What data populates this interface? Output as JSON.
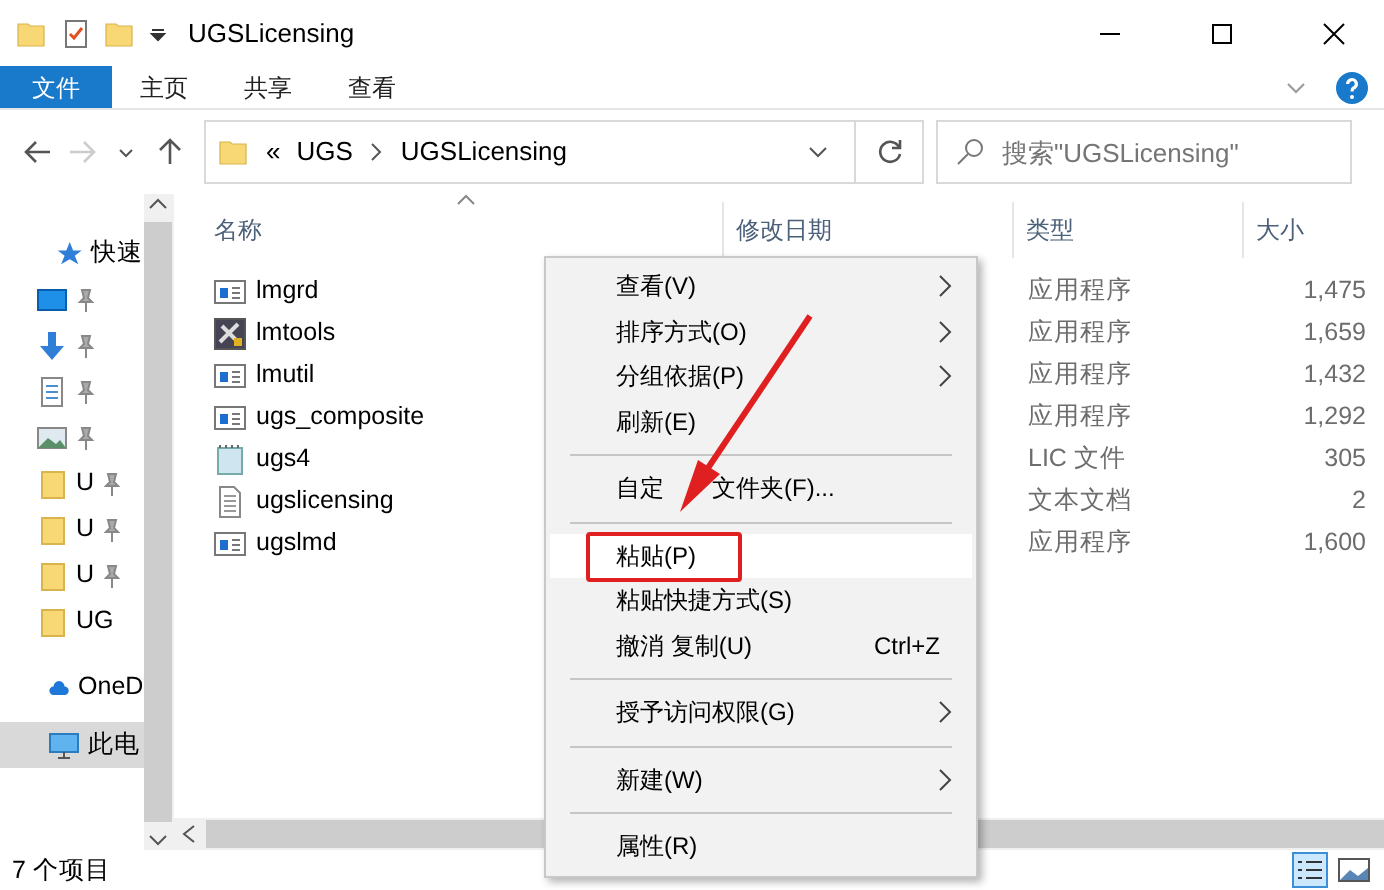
{
  "window": {
    "title": "UGSLicensing"
  },
  "ribbon_tabs": [
    {
      "label": "文件",
      "selected": true
    },
    {
      "label": "主页",
      "selected": false
    },
    {
      "label": "共享",
      "selected": false
    },
    {
      "label": "查看",
      "selected": false
    }
  ],
  "address": {
    "prefix": "«",
    "segments": [
      "UGS",
      "UGSLicensing"
    ]
  },
  "search": {
    "placeholder": "搜索\"UGSLicensing\""
  },
  "nav_items": [
    {
      "kind": "star",
      "label": "快速",
      "pinned": false,
      "selected": false
    },
    {
      "kind": "desktop",
      "pinned": true,
      "selected": false
    },
    {
      "kind": "download",
      "pinned": true,
      "selected": false
    },
    {
      "kind": "document",
      "pinned": true,
      "selected": false
    },
    {
      "kind": "image",
      "pinned": true,
      "selected": false
    },
    {
      "kind": "folder",
      "label": "U",
      "pinned": true,
      "selected": false
    },
    {
      "kind": "folder",
      "label": "U",
      "pinned": true,
      "selected": false
    },
    {
      "kind": "folder",
      "label": "U",
      "pinned": true,
      "selected": false
    },
    {
      "kind": "folder",
      "label": "UG",
      "pinned": false,
      "selected": false
    },
    {
      "kind": "cloud",
      "label": "OneD",
      "pinned": false,
      "selected": false
    },
    {
      "kind": "pc",
      "label": "此电",
      "pinned": false,
      "selected": true
    }
  ],
  "columns": [
    "名称",
    "修改日期",
    "类型",
    "大小"
  ],
  "files": [
    {
      "kind": "app",
      "name": "lmgrd",
      "type": "应用程序",
      "size": "1,475"
    },
    {
      "kind": "tool",
      "name": "lmtools",
      "type": "应用程序",
      "size": "1,659"
    },
    {
      "kind": "app",
      "name": "lmutil",
      "type": "应用程序",
      "size": "1,432"
    },
    {
      "kind": "app",
      "name": "ugs_composite",
      "type": "应用程序",
      "size": "1,292"
    },
    {
      "kind": "lic",
      "name": "ugs4",
      "type": "LIC 文件",
      "size": "305"
    },
    {
      "kind": "text",
      "name": "ugslicensing",
      "type": "文本文档",
      "size": "2"
    },
    {
      "kind": "app",
      "name": "ugslmd",
      "type": "应用程序",
      "size": "1,600"
    }
  ],
  "context_menu": {
    "items": [
      {
        "kind": "item",
        "label": "查看(V)",
        "submenu": true,
        "selected": false
      },
      {
        "kind": "item",
        "label": "排序方式(O)",
        "submenu": true,
        "selected": false
      },
      {
        "kind": "item",
        "label": "分组依据(P)",
        "submenu": true,
        "selected": false
      },
      {
        "kind": "item",
        "label": "刷新(E)",
        "submenu": false,
        "selected": false
      },
      {
        "kind": "separator"
      },
      {
        "kind": "item",
        "label": "自定",
        "label_after_arrow": "文件夹(F)...",
        "submenu": false,
        "selected": false
      },
      {
        "kind": "separator"
      },
      {
        "kind": "item",
        "label": "粘贴(P)",
        "submenu": false,
        "selected": true
      },
      {
        "kind": "item",
        "label": "粘贴快捷方式(S)",
        "submenu": false,
        "selected": false
      },
      {
        "kind": "item",
        "label": "撤消 复制(U)",
        "shortcut": "Ctrl+Z",
        "submenu": false,
        "selected": false
      },
      {
        "kind": "separator"
      },
      {
        "kind": "item",
        "label": "授予访问权限(G)",
        "submenu": true,
        "selected": false
      },
      {
        "kind": "separator"
      },
      {
        "kind": "item",
        "label": "新建(W)",
        "submenu": true,
        "selected": false
      },
      {
        "kind": "separator"
      },
      {
        "kind": "item",
        "label": "属性(R)",
        "submenu": false,
        "selected": false
      }
    ]
  },
  "status_bar": {
    "text": "7 个项目"
  }
}
